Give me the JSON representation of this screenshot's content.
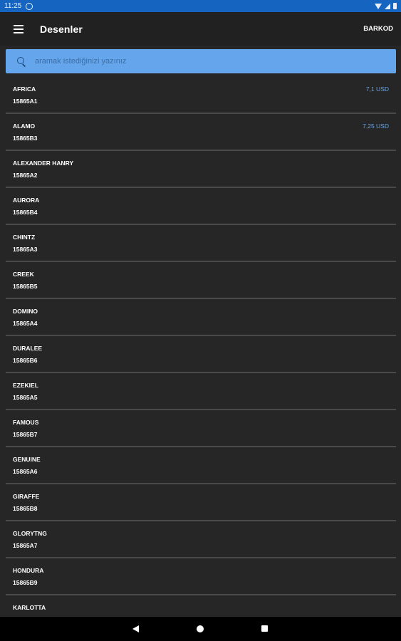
{
  "status": {
    "time": "11:25"
  },
  "app_bar": {
    "title": "Desenler",
    "barkod_label": "BARKOD"
  },
  "search": {
    "placeholder": "aramak istediğinizi yazınız",
    "value": ""
  },
  "items": [
    {
      "name": "AFRICA",
      "code": "15865A1",
      "price": "7,1 USD"
    },
    {
      "name": "ALAMO",
      "code": "15865B3",
      "price": "7,25 USD"
    },
    {
      "name": "ALEXANDER HANRY",
      "code": "15865A2",
      "price": ""
    },
    {
      "name": "AURORA",
      "code": "15865B4",
      "price": ""
    },
    {
      "name": "CHINTZ",
      "code": "15865A3",
      "price": ""
    },
    {
      "name": "CREEK",
      "code": "15865B5",
      "price": ""
    },
    {
      "name": "DOMINO",
      "code": "15865A4",
      "price": ""
    },
    {
      "name": "DURALEE",
      "code": "15865B6",
      "price": ""
    },
    {
      "name": "EZEKIEL",
      "code": "15865A5",
      "price": ""
    },
    {
      "name": "FAMOUS",
      "code": "15865B7",
      "price": ""
    },
    {
      "name": "GENUINE",
      "code": "15865A6",
      "price": ""
    },
    {
      "name": "GIRAFFE",
      "code": "15865B8",
      "price": ""
    },
    {
      "name": "GLORYTNG",
      "code": "15865A7",
      "price": ""
    },
    {
      "name": "HONDURA",
      "code": "15865B9",
      "price": ""
    },
    {
      "name": "KARLOTTA",
      "code": "",
      "price": ""
    }
  ]
}
